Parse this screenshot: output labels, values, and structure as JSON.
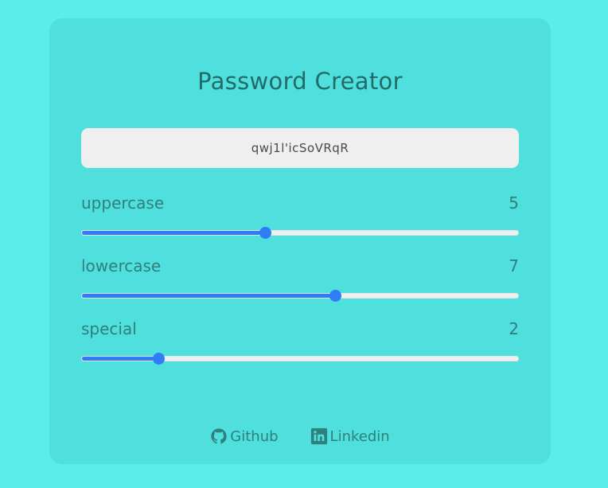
{
  "app": {
    "title": "Password Creator"
  },
  "password": {
    "value": "qwj1l'icSoVRqR"
  },
  "sliders": [
    {
      "label": "uppercase",
      "value": "5",
      "fraction": 0.42
    },
    {
      "label": "lowercase",
      "value": "7",
      "fraction": 0.58
    },
    {
      "label": "special",
      "value": "2",
      "fraction": 0.175
    }
  ],
  "footer": {
    "github_label": "Github",
    "linkedin_label": "Linkedin"
  },
  "colors": {
    "background": "#5aeeea",
    "card": "#4fe0dd",
    "accent": "#2f7cf6",
    "text": "#2f7f7d"
  }
}
